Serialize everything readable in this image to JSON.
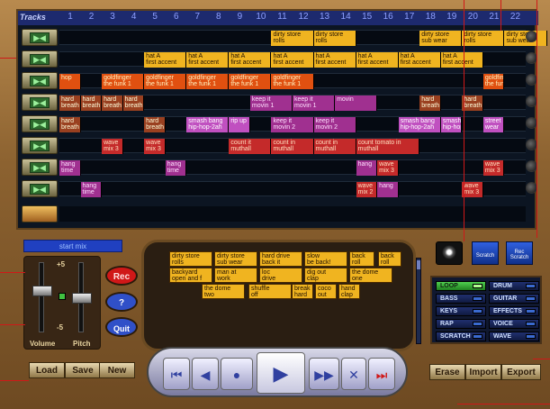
{
  "sequencer": {
    "title": "Tracks",
    "bars": [
      "1",
      "2",
      "3",
      "4",
      "5",
      "6",
      "7",
      "8",
      "9",
      "10",
      "11",
      "12",
      "13",
      "14",
      "15",
      "16",
      "17",
      "18",
      "19",
      "20",
      "21",
      "22"
    ],
    "tracks": [
      {
        "clips": [
          {
            "t": "dirty store\nsub wear",
            "c": "c-y"
          },
          {
            "t": "dirty store\nrolls",
            "c": "c-y"
          },
          {
            "t": "dirty store\nsub wear",
            "c": "c-y"
          },
          {
            "t": "dirty store\nrolls",
            "c": "c-y"
          },
          {
            "t": "dirty store\nsub wear",
            "c": "c-y"
          },
          {
            "t": "dirty store\nrolls",
            "c": "c-y"
          }
        ]
      },
      {
        "clips": [
          {
            "t": "hat A\nfirst accent",
            "c": "c-y"
          },
          {
            "t": "hat A\nfirst accent",
            "c": "c-y"
          },
          {
            "t": "hat A\nfirst accent",
            "c": "c-y"
          },
          {
            "t": "hat A\nfirst accent",
            "c": "c-y"
          },
          {
            "t": "hat A\nfirst accent",
            "c": "c-y"
          },
          {
            "t": "hat A\nfirst accent",
            "c": "c-y"
          },
          {
            "t": "hat A\nfirst accent",
            "c": "c-y"
          },
          {
            "t": "hat A\nfirst accent",
            "c": "c-y"
          }
        ]
      },
      {
        "clips": [
          {
            "t": "hop",
            "c": "c-o"
          },
          {
            "t": "goldfinger\nthe funk 1",
            "c": "c-o"
          },
          {
            "t": "goldfinger\nthe funk 1",
            "c": "c-o"
          },
          {
            "t": "goldfinger\nthe funk 1",
            "c": "c-o"
          },
          {
            "t": "goldfinger\nthe funk 1",
            "c": "c-o"
          },
          {
            "t": "goldfinger\nthe funk 1",
            "c": "c-o"
          },
          {
            "t": "goldfinger\nthe funk 1",
            "c": "c-o"
          }
        ]
      },
      {
        "clips": [
          {
            "t": "hard\nbreath",
            "c": "c-br"
          },
          {
            "t": "hard\nbreath",
            "c": "c-br"
          },
          {
            "t": "hard\nbreath",
            "c": "c-br"
          },
          {
            "t": "hard\nbreath",
            "c": "c-br"
          },
          {
            "t": "keep it\nmovin 1",
            "c": "c-m"
          },
          {
            "t": "keep it\nmovin 1",
            "c": "c-m"
          },
          {
            "t": "movin",
            "c": "c-m"
          },
          {
            "t": "hard\nbreath",
            "c": "c-br"
          },
          {
            "t": "hard\nbreath",
            "c": "c-br"
          }
        ]
      },
      {
        "clips": [
          {
            "t": "hard\nbreath",
            "c": "c-br"
          },
          {
            "t": "hard\nbreath",
            "c": "c-br"
          },
          {
            "t": "smash bang\nhip-hop-2ah",
            "c": "c-p"
          },
          {
            "t": "rip up",
            "c": "c-p"
          },
          {
            "t": "keep it\nmovin 2",
            "c": "c-m"
          },
          {
            "t": "keep it\nmovin 2",
            "c": "c-m"
          },
          {
            "t": "smash bang\nhip-hop-2ah",
            "c": "c-p"
          },
          {
            "t": "smash bang\nhip-hop",
            "c": "c-p"
          },
          {
            "t": "street\nwear",
            "c": "c-p"
          }
        ]
      },
      {
        "clips": [
          {
            "t": "wave\nmix 3",
            "c": "c-r"
          },
          {
            "t": "wave\nmix 3",
            "c": "c-r"
          },
          {
            "t": "count it\nmuthall",
            "c": "c-r"
          },
          {
            "t": "count in\nmuthall",
            "c": "c-r"
          },
          {
            "t": "count in\nmuthall",
            "c": "c-r"
          },
          {
            "t": "count tomato in\nmuthall",
            "c": "c-r"
          }
        ]
      },
      {
        "clips": [
          {
            "t": "hang\ntime",
            "c": "c-m"
          },
          {
            "t": "hang\ntime",
            "c": "c-m"
          },
          {
            "t": "hang",
            "c": "c-m"
          },
          {
            "t": "wave\nmix 3",
            "c": "c-r"
          },
          {
            "t": "wave\nmix 3",
            "c": "c-r"
          }
        ]
      },
      {
        "clips": [
          {
            "t": "hang\ntime",
            "c": "c-m"
          },
          {
            "t": "wave\nmix 2",
            "c": "c-r"
          },
          {
            "t": "hang",
            "c": "c-m"
          },
          {
            "t": "wave\nmix 3",
            "c": "c-r"
          }
        ]
      }
    ]
  },
  "mixer": {
    "label": "start mix",
    "volume_label": "Volume",
    "pitch_label": "Pitch",
    "plus": "+5",
    "minus": "-5"
  },
  "buttons": {
    "rec": "Rec",
    "help": "?",
    "quit": "Quit",
    "load": "Load",
    "save": "Save",
    "new": "New",
    "erase": "Erase",
    "import": "Import",
    "export": "Export"
  },
  "hub_clips": [
    {
      "t": "dirty store\nrolls"
    },
    {
      "t": "dirty store\nsub wear"
    },
    {
      "t": "hard drive\nback it"
    },
    {
      "t": "slow\nbe back!"
    },
    {
      "t": "back\nroll"
    },
    {
      "t": "back\nroll"
    },
    {
      "t": "backyard\nopen and f"
    },
    {
      "t": "man at\nwork"
    },
    {
      "t": "loc\ndrive"
    },
    {
      "t": "dig out\nclap"
    },
    {
      "t": "the dome\none"
    },
    {
      "t": "the dome\ntwo"
    },
    {
      "t": "shuffle\noff"
    },
    {
      "t": "break\nhard"
    },
    {
      "t": "coco\nout"
    },
    {
      "t": "hand\nclap"
    }
  ],
  "scratch": {
    "scratch": "Scratch",
    "rec_scratch": "Rec\nScratch"
  },
  "genres": [
    {
      "label": "LOOP",
      "on": true
    },
    {
      "label": "DRUM",
      "on": false
    },
    {
      "label": "BASS",
      "on": false
    },
    {
      "label": "GUITAR",
      "on": false
    },
    {
      "label": "KEYS",
      "on": false
    },
    {
      "label": "EFFECTS",
      "on": false
    },
    {
      "label": "RAP",
      "on": false
    },
    {
      "label": "VOICE",
      "on": false
    },
    {
      "label": "SCRATCH",
      "on": false
    },
    {
      "label": "WAVE",
      "on": false
    }
  ],
  "transport": {
    "rewind_start": "⏮",
    "rewind": "◀",
    "stop": "●",
    "play": "▶",
    "forward": "▶▶",
    "loop": "✕",
    "end": "⏭"
  }
}
